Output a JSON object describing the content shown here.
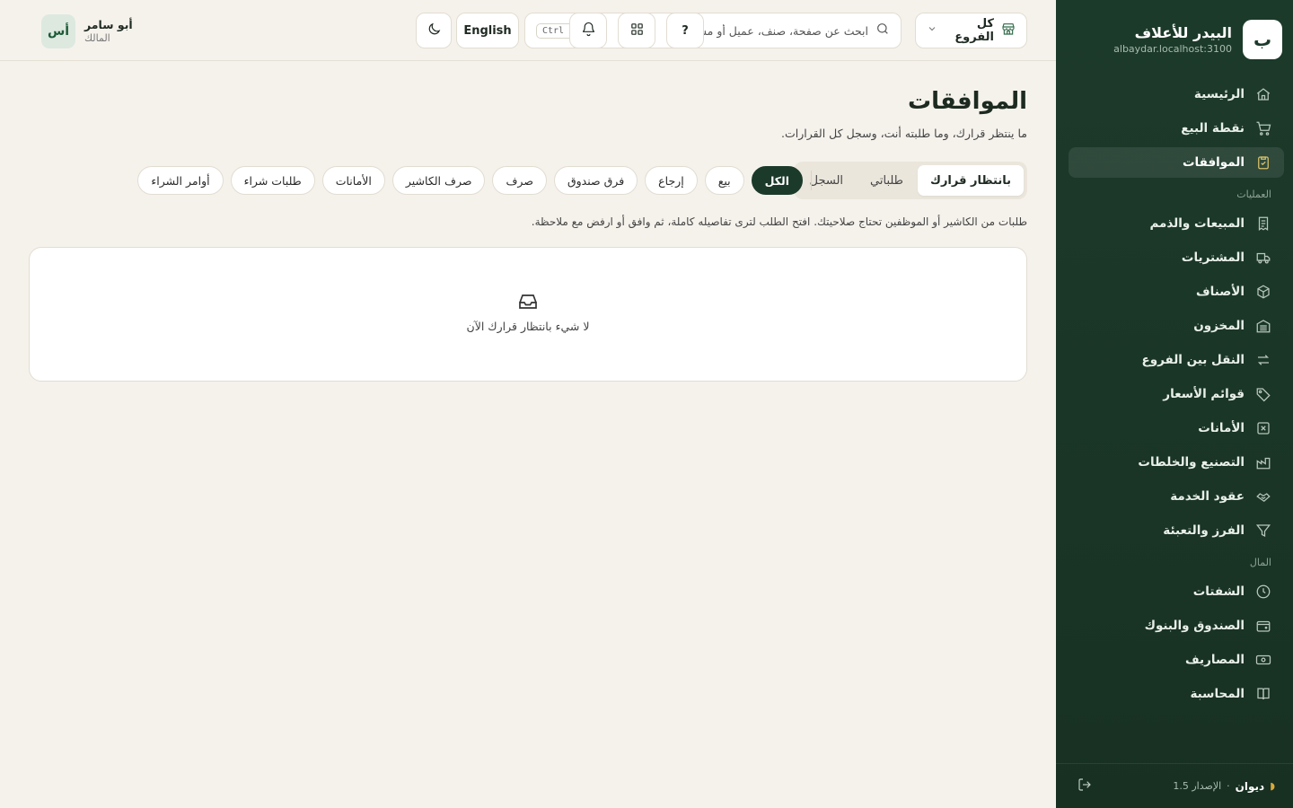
{
  "brand": {
    "logo_letter": "ب",
    "name": "البيدر للأعلاف",
    "host": "albaydar.localhost:3100"
  },
  "sidebar": {
    "top_items": [
      {
        "label": "الرئيسية",
        "icon": "home-icon"
      },
      {
        "label": "نقطة البيع",
        "icon": "cart-icon"
      },
      {
        "label": "الموافقات",
        "icon": "clipboard-check-icon",
        "active": true
      }
    ],
    "section_ops": "العمليات",
    "ops_items": [
      {
        "label": "المبيعات والذمم",
        "icon": "receipt-icon"
      },
      {
        "label": "المشتريات",
        "icon": "truck-icon"
      },
      {
        "label": "الأصناف",
        "icon": "box-icon"
      },
      {
        "label": "المخزون",
        "icon": "warehouse-icon"
      },
      {
        "label": "النقل بين الفروع",
        "icon": "transfer-icon"
      },
      {
        "label": "قوائم الأسعار",
        "icon": "tag-icon"
      },
      {
        "label": "الأمانات",
        "icon": "x-box-icon"
      },
      {
        "label": "التصنيع والخلطات",
        "icon": "factory-icon"
      },
      {
        "label": "عقود الخدمة",
        "icon": "handshake-icon"
      },
      {
        "label": "الفرز والتعبئة",
        "icon": "filter-icon"
      }
    ],
    "section_money": "المال",
    "money_items": [
      {
        "label": "الشفتات",
        "icon": "clock-icon"
      },
      {
        "label": "الصندوق والبنوك",
        "icon": "wallet-icon"
      },
      {
        "label": "المصاريف",
        "icon": "banknote-icon"
      },
      {
        "label": "المحاسبة",
        "icon": "book-icon"
      }
    ],
    "footer": {
      "brand": "ديوان",
      "version": "الإصدار 1.5",
      "separator": "·"
    }
  },
  "topbar": {
    "branch_label": "كل الفروع",
    "search_placeholder": "ابحث عن صفحة، صنف، عميل أو مستند...",
    "search_shortcut": "Ctrl K",
    "help_label": "?",
    "language_label": "English",
    "user": {
      "initials": "أس",
      "name": "أبو سامر",
      "role": "المالك"
    }
  },
  "page": {
    "title": "الموافقات",
    "subtitle": "ما ينتظر قرارك، وما طلبته أنت، وسجل كل القرارات.",
    "segments": [
      "بانتظار قرارك",
      "طلباتي",
      "السجل"
    ],
    "active_segment": 0,
    "filters": [
      "الكل",
      "بيع",
      "إرجاع",
      "فرق صندوق",
      "صرف",
      "صرف الكاشير",
      "الأمانات",
      "طلبات شراء",
      "أوامر الشراء"
    ],
    "active_filter": 0,
    "hint": "طلبات من الكاشير أو الموظفين تحتاج صلاحيتك. افتح الطلب لترى تفاصيله كاملة، ثم وافق أو ارفض مع ملاحظة.",
    "empty_text": "لا شيء بانتظار قرارك الآن"
  }
}
